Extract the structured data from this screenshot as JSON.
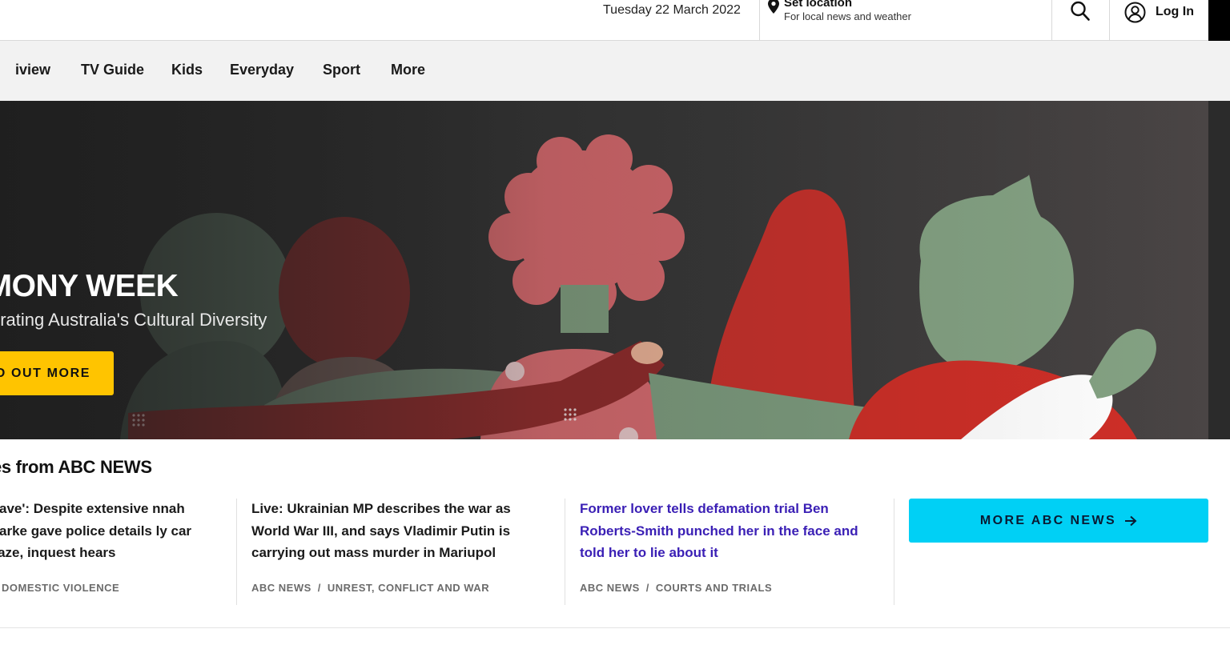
{
  "header": {
    "date": "Tuesday 22 March 2022",
    "location_title": "Set location",
    "location_subtitle": "For local news and weather",
    "search_icon": "search-icon",
    "login_label": "Log In",
    "login_icon": "user-circle-icon"
  },
  "nav": {
    "items": [
      {
        "label": "iview"
      },
      {
        "label": "TV Guide"
      },
      {
        "label": "Kids"
      },
      {
        "label": "Everyday"
      },
      {
        "label": "Sport"
      },
      {
        "label": "More"
      }
    ]
  },
  "hero": {
    "title": "RMONY WEEK",
    "subtitle": "orating Australia's Cultural Diversity",
    "button_label": "D OUT MORE",
    "button_color": "#ffc400",
    "background_color": "#2e2e2e"
  },
  "news": {
    "section_title": "es from ABC NEWS",
    "stories": [
      {
        "headline": "brave': Despite extensive nnah Clarke gave police details ly car blaze, inquest hears",
        "meta_source": "",
        "meta_topic": "DOMESTIC VIOLENCE"
      },
      {
        "headline": "Live: Ukrainian MP describes the war as World War III, and says Vladimir Putin is carrying out mass murder in Mariupol",
        "meta_source": "ABC NEWS",
        "meta_topic": "UNREST, CONFLICT AND WAR"
      },
      {
        "headline": "Former lover tells defamation trial Ben Roberts-Smith punched her in the face and told her to lie about it",
        "meta_source": "ABC NEWS",
        "meta_topic": "COURTS AND TRIALS"
      }
    ],
    "more_button_label": "MORE ABC NEWS",
    "more_button_color": "#00d0f5",
    "separator": "/"
  }
}
